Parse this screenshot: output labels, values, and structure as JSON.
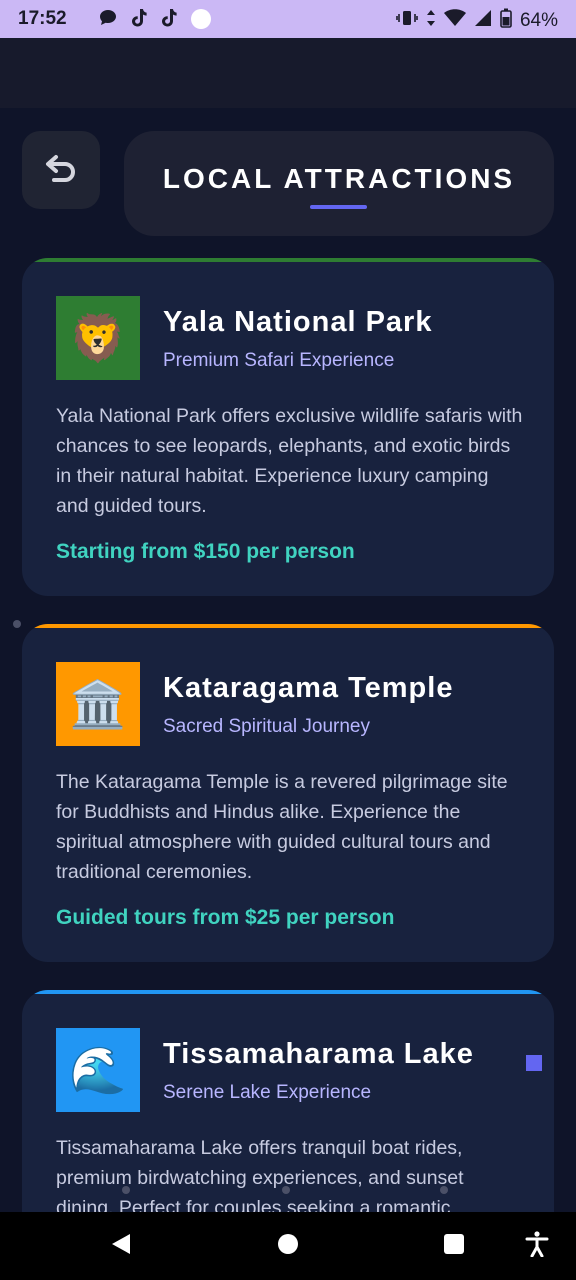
{
  "status_bar": {
    "time": "17:52",
    "battery": "64%",
    "notif_icons": [
      "chat-bubble-icon",
      "tiktok-icon",
      "tiktok-icon",
      "circle-icon"
    ],
    "system_icons": [
      "vibrate-icon",
      "data-arrows-icon",
      "wifi-icon",
      "signal-icon",
      "battery-icon"
    ]
  },
  "header": {
    "title": "LOCAL ATTRACTIONS",
    "back_icon": "undo-arrow-icon",
    "accent_color": "#6366f1"
  },
  "attractions": [
    {
      "name": "Yala National Park",
      "subtitle": "Premium Safari Experience",
      "description": "Yala National Park offers exclusive wildlife safaris with chances to see leopards, elephants, and exotic birds in their natural habitat. Experience luxury camping and guided tours.",
      "price": "Starting from $150 per person",
      "icon": "lion-icon",
      "emoji": "🦁",
      "accent_color": "#2e7d32",
      "thumb_bg": "#2e7d32"
    },
    {
      "name": "Kataragama Temple",
      "subtitle": "Sacred Spiritual Journey",
      "description": "The Kataragama Temple is a revered pilgrimage site for Buddhists and Hindus alike. Experience the spiritual atmosphere with guided cultural tours and traditional ceremonies.",
      "price": "Guided tours from $25 per person",
      "icon": "temple-icon",
      "emoji": "🏛️",
      "accent_color": "#ff9800",
      "thumb_bg": "#ff9800"
    },
    {
      "name": "Tissamaharama Lake",
      "subtitle": "Serene Lake Experience",
      "description": "Tissamaharama Lake offers tranquil boat rides, premium birdwatching experiences, and sunset dining. Perfect for couples seeking a romantic",
      "price": "",
      "icon": "wave-icon",
      "emoji": "🌊",
      "accent_color": "#2196f3",
      "thumb_bg": "#2196f3"
    }
  ],
  "nav_bar": {
    "back_icon": "triangle-back-icon",
    "home_icon": "circle-home-icon",
    "recents_icon": "square-recents-icon",
    "accessibility_icon": "accessibility-icon"
  }
}
